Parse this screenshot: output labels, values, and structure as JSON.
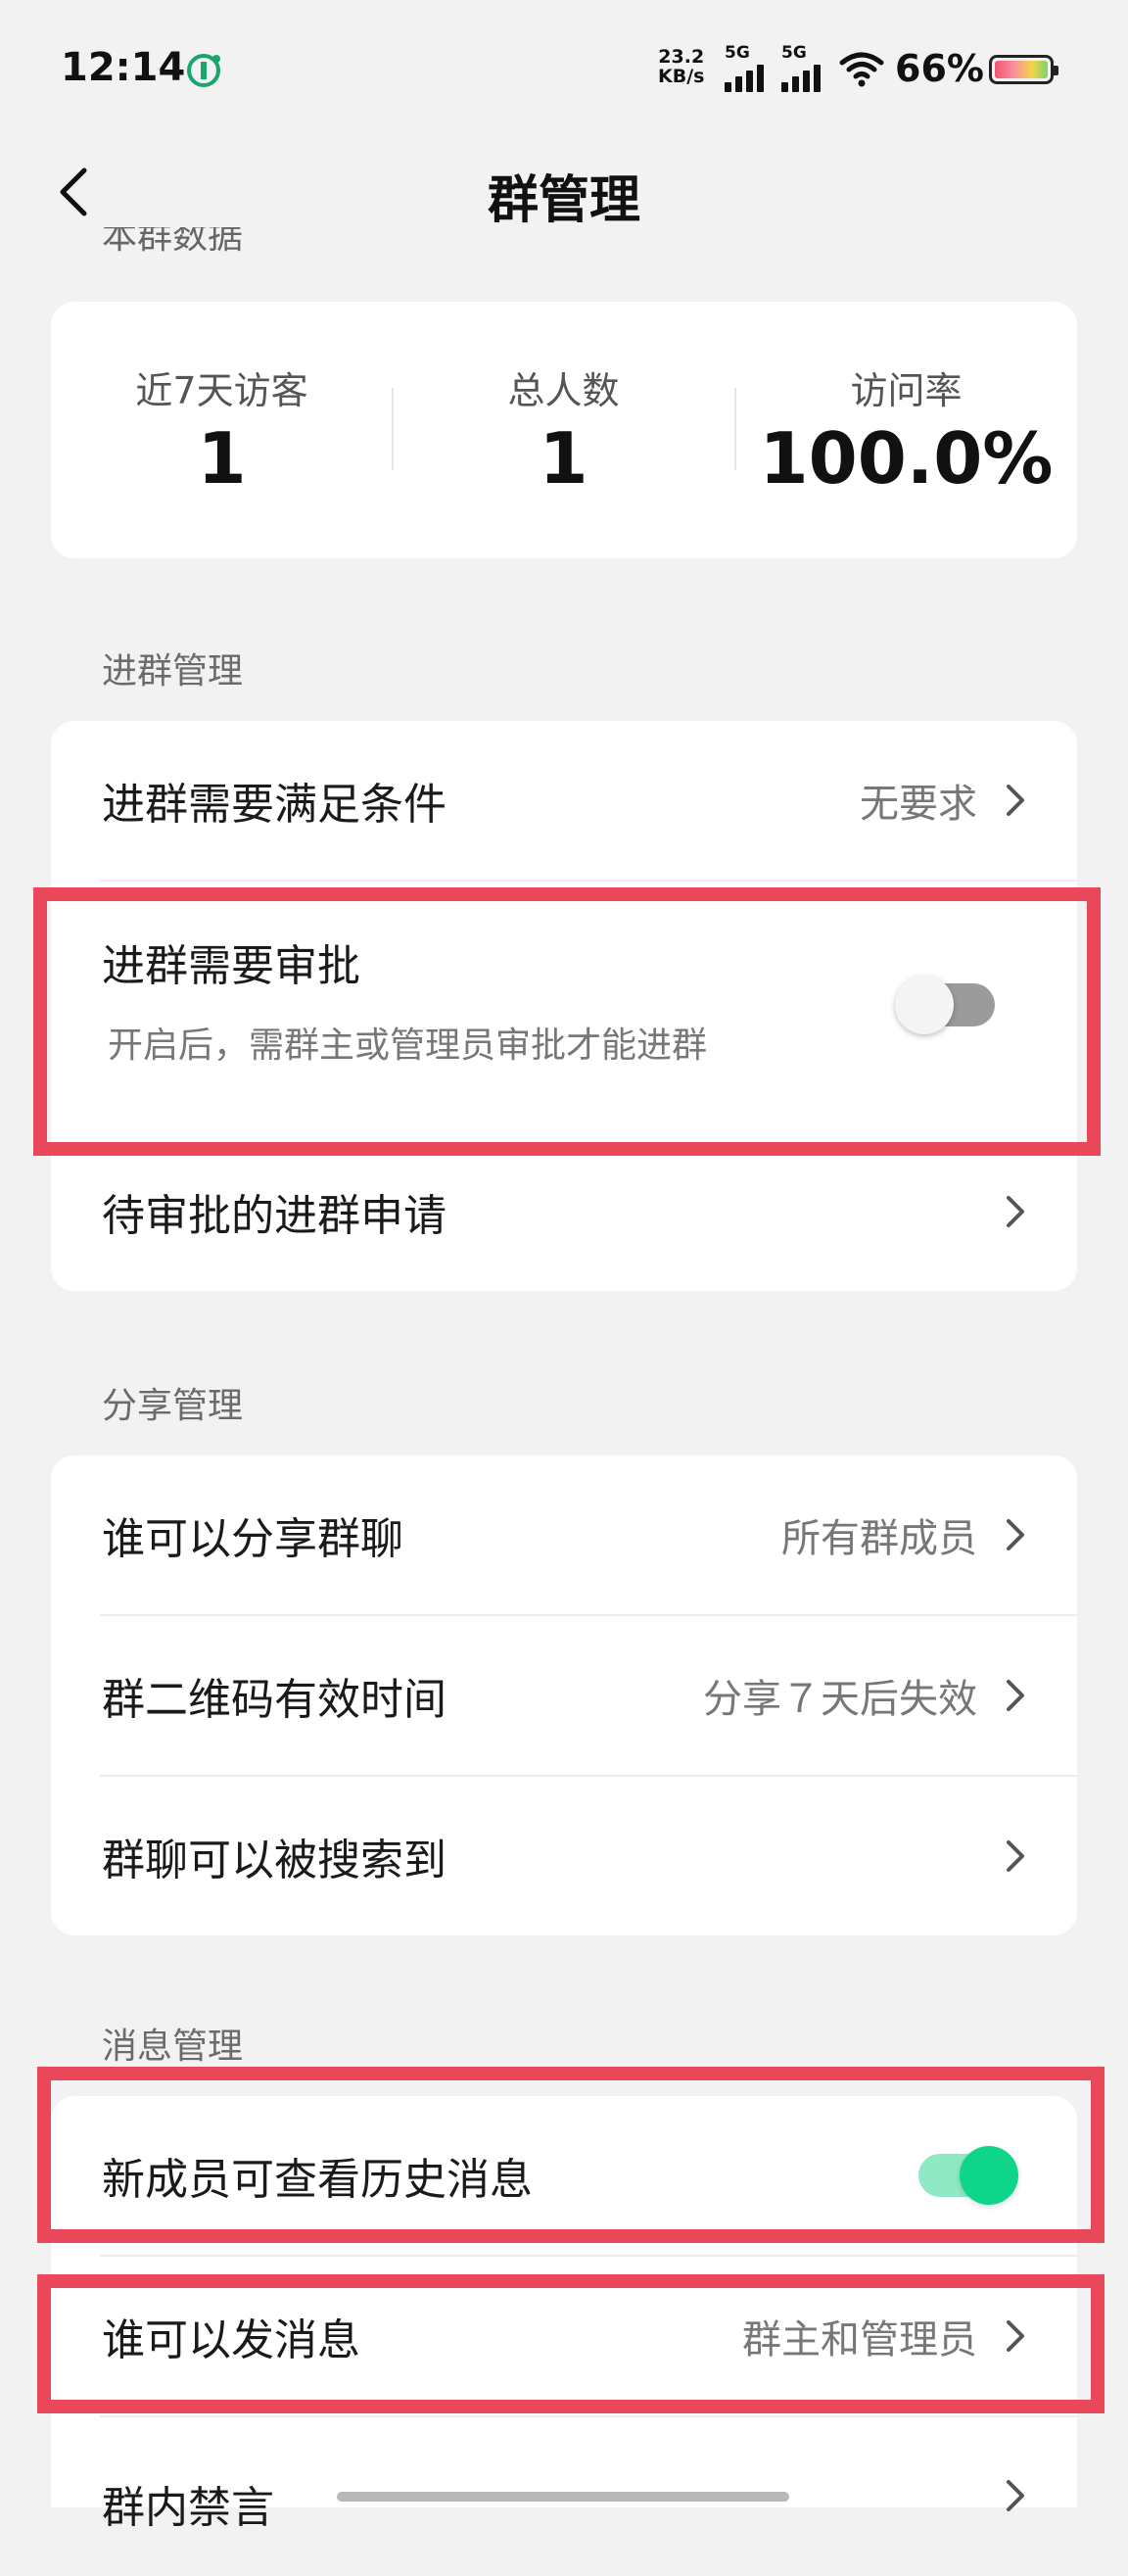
{
  "status_bar": {
    "time": "12:14",
    "net_speed_value": "23.2",
    "net_speed_unit": "KB/s",
    "sim1_label": "5G",
    "sim2_label": "5G",
    "battery_pct": "66%"
  },
  "nav": {
    "title": "群管理"
  },
  "clipped_section_label": "本群数据",
  "stats": [
    {
      "label": "近7天访客",
      "value": "1"
    },
    {
      "label": "总人数",
      "value": "1"
    },
    {
      "label": "访问率",
      "value": "100.0%"
    }
  ],
  "join_section": {
    "label": "进群管理",
    "condition": {
      "title": "进群需要满足条件",
      "value": "无要求"
    },
    "approval": {
      "title": "进群需要审批",
      "subtitle": "开启后，需群主或管理员审批才能进群",
      "enabled": false
    },
    "pending": {
      "title": "待审批的进群申请"
    }
  },
  "share_section": {
    "label": "分享管理",
    "who_share": {
      "title": "谁可以分享群聊",
      "value": "所有群成员"
    },
    "qr_valid": {
      "title": "群二维码有效时间",
      "value": "分享７天后失效"
    },
    "searchable": {
      "title": "群聊可以被搜索到"
    }
  },
  "message_section": {
    "label": "消息管理",
    "history": {
      "title": "新成员可查看历史消息",
      "enabled": true
    },
    "who_send": {
      "title": "谁可以发消息",
      "value": "群主和管理员"
    },
    "mute": {
      "title": "群内禁言"
    }
  },
  "colors": {
    "highlight": "#e8485a",
    "toggle_on": "#0fd58a",
    "background": "#f2f2f2"
  }
}
